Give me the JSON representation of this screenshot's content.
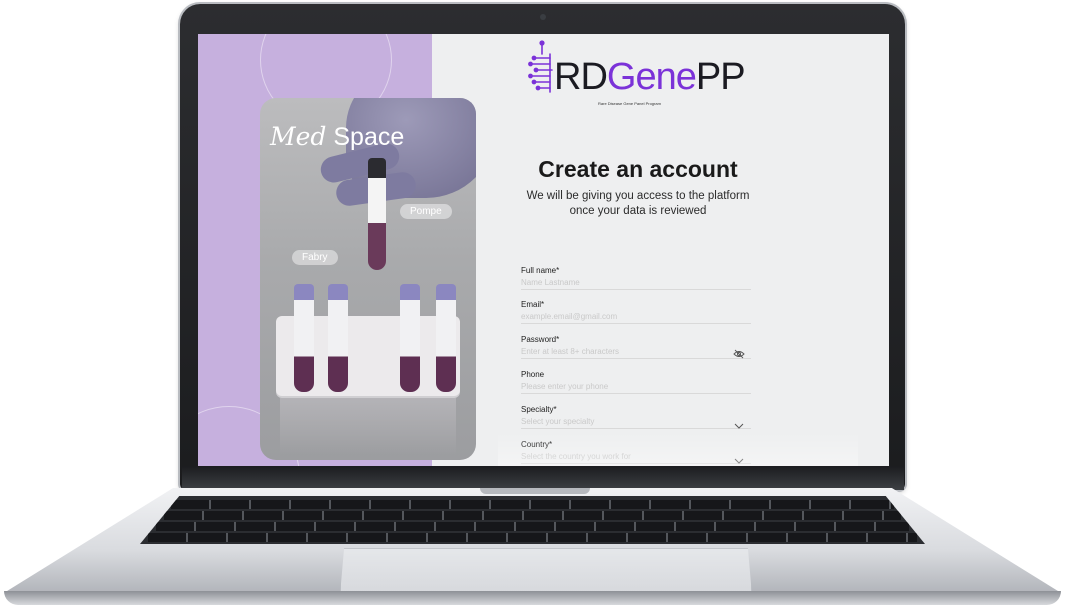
{
  "brand": {
    "card_brand_italic": "Med",
    "card_brand_regular": "Space",
    "logo_rd": "RD",
    "logo_gene": "Gene",
    "logo_pp": "PP",
    "logo_subtitle": "Rare Disease Gene Panel Program"
  },
  "chips": {
    "pompe": "Pompe",
    "fabry": "Fabry"
  },
  "form": {
    "title": "Create an account",
    "subtitle": "We will be giving you access to the platform\nonce your data is reviewed",
    "full_name": {
      "label": "Full name*",
      "placeholder": "Name Lastname"
    },
    "email": {
      "label": "Email*",
      "placeholder": "example.email@gmail.com"
    },
    "password": {
      "label": "Password*",
      "placeholder": "Enter at least 8+ characters"
    },
    "phone": {
      "label": "Phone",
      "placeholder": "Please enter your phone"
    },
    "specialty": {
      "label": "Specialty*",
      "placeholder": "Select your specialty"
    },
    "country": {
      "label": "Country*",
      "placeholder": "Select the country you work for"
    }
  },
  "colors": {
    "accent_purple": "#7b32d8",
    "panel_lavender": "#c6b0de"
  },
  "icons": {
    "password_toggle": "eye-off-icon",
    "dropdown": "chevron-down-icon"
  }
}
